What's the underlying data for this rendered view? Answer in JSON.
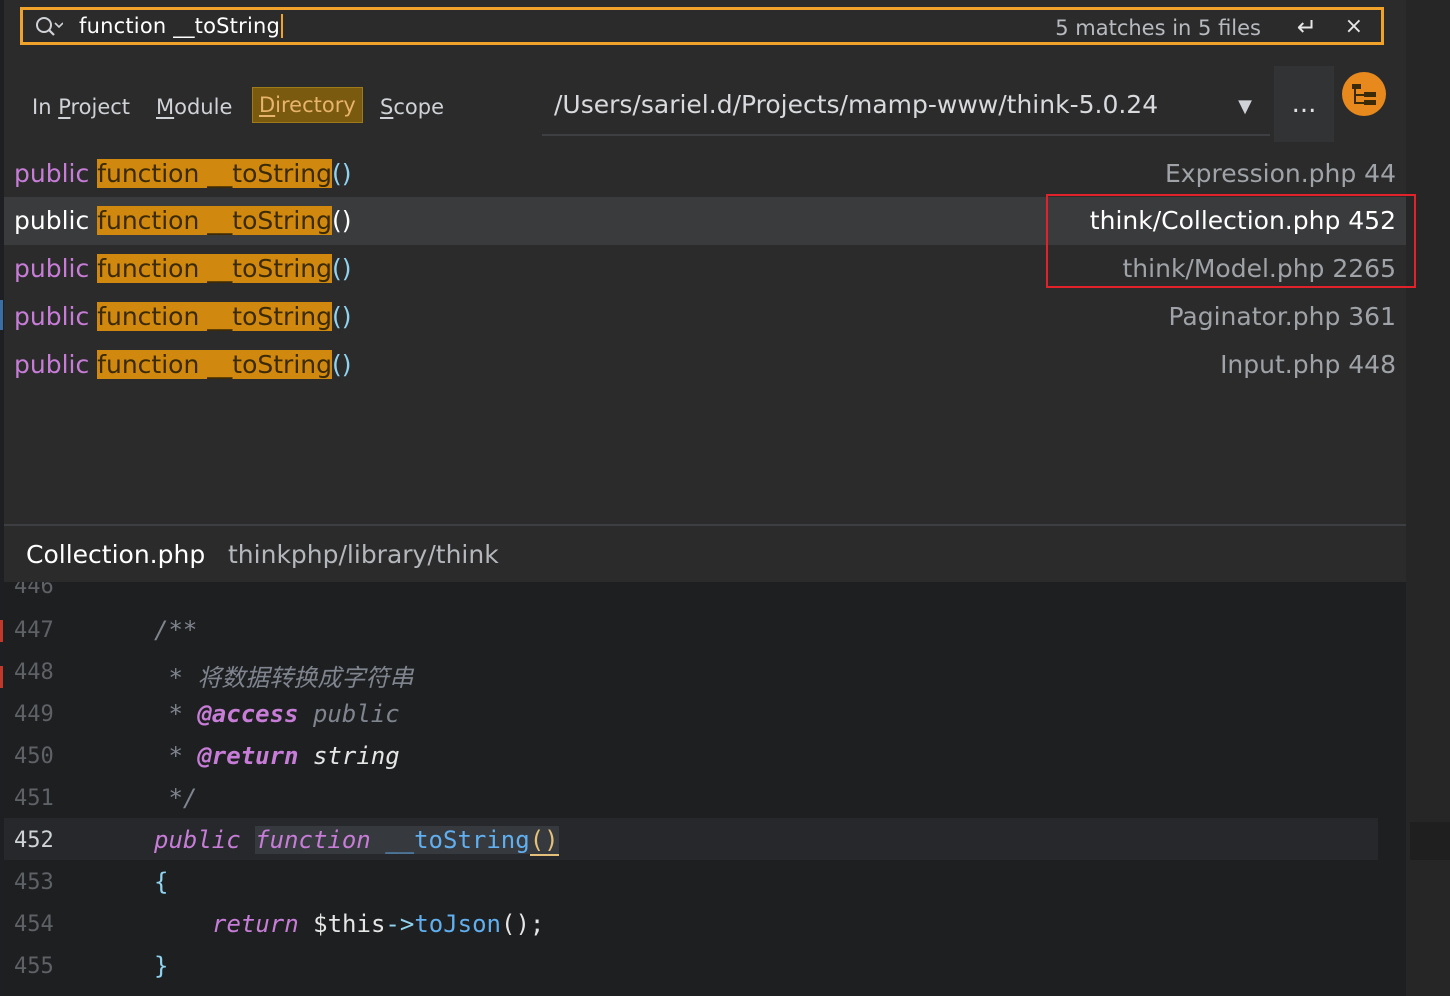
{
  "search": {
    "query": "function __toString",
    "match_count": "5 matches in 5 files",
    "enter_symbol": "↵",
    "close_symbol": "×"
  },
  "scope_tabs": [
    {
      "label_pre": "In ",
      "label_u": "P",
      "label_post": "roject"
    },
    {
      "label_pre": "",
      "label_u": "M",
      "label_post": "odule"
    },
    {
      "label_pre": "",
      "label_u": "D",
      "label_post": "irectory"
    },
    {
      "label_pre": "",
      "label_u": "S",
      "label_post": "cope"
    }
  ],
  "active_tab": "Directory",
  "directory_path": "/Users/sariel.d/Projects/mamp-www/think-5.0.24",
  "more_button": "...",
  "results": [
    {
      "kw": "public",
      "m1": "function",
      "m2": "__toString",
      "paren": "()",
      "file": "Expression.php 44"
    },
    {
      "kw": "public",
      "m1": "function",
      "m2": "__toString",
      "paren": "()",
      "file": "think/Collection.php 452"
    },
    {
      "kw": "public",
      "m1": "function",
      "m2": "__toString",
      "paren": "()",
      "file": "think/Model.php 2265"
    },
    {
      "kw": "public",
      "m1": "function",
      "m2": "__toString",
      "paren": "()",
      "file": "Paginator.php 361"
    },
    {
      "kw": "public",
      "m1": "function",
      "m2": "__toString",
      "paren": "()",
      "file": "Input.php 448"
    }
  ],
  "selected_result": 1,
  "preview": {
    "file_name": "Collection.php",
    "file_dir": "thinkphp/library/think"
  },
  "code": {
    "line_numbers": [
      "446",
      "447",
      "448",
      "449",
      "450",
      "451",
      "452",
      "453",
      "454",
      "455"
    ],
    "l447": "/**",
    "l448": " * 将数据转换成字符串",
    "l449_star": " * ",
    "l449_tag": "@access",
    "l449_val": " public",
    "l450_star": " * ",
    "l450_tag": "@return",
    "l450_val": " string",
    "l451": " */",
    "l452_kw1": "public",
    "l452_kw2": "function",
    "l452_fn": "__toString",
    "l452_paren": "()",
    "l453": "{",
    "l454_kw": "return",
    "l454_var": "$this",
    "l454_op": "->",
    "l454_fn": "toJson",
    "l454_end": "();",
    "l455": "}"
  },
  "colors": {
    "accent": "#f0a22a",
    "highlight": "#d0890e",
    "annotation_box": "#e1222a"
  }
}
